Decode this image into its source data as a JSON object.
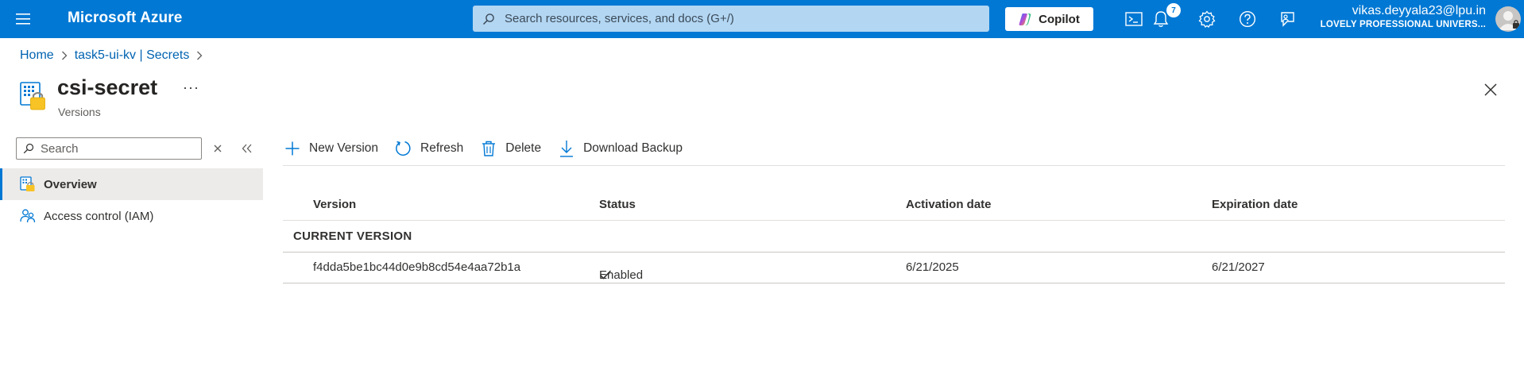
{
  "topbar": {
    "brand": "Microsoft Azure",
    "search_placeholder": "Search resources, services, and docs (G+/)",
    "copilot_label": "Copilot",
    "notification_count": "7",
    "account_email": "vikas.deyyala23@lpu.in",
    "account_org": "LOVELY PROFESSIONAL UNIVERS...",
    "icons": [
      "cloud-shell-icon",
      "notifications-icon",
      "settings-icon",
      "help-icon",
      "feedback-icon"
    ]
  },
  "breadcrumb": [
    {
      "label": "Home"
    },
    {
      "label": "task5-ui-kv | Secrets"
    }
  ],
  "page": {
    "title": "csi-secret",
    "more": "···",
    "subtitle": "Versions"
  },
  "nav": {
    "search_placeholder": "Search",
    "items": [
      {
        "label": "Overview",
        "icon": "overview-icon",
        "active": true
      },
      {
        "label": "Access control (IAM)",
        "icon": "iam-icon",
        "active": false
      }
    ]
  },
  "commands": [
    {
      "label": "New Version",
      "icon": "plus-icon"
    },
    {
      "label": "Refresh",
      "icon": "refresh-icon"
    },
    {
      "label": "Delete",
      "icon": "trash-icon"
    },
    {
      "label": "Download Backup",
      "icon": "download-icon"
    }
  ],
  "table": {
    "columns": [
      "Version",
      "Status",
      "Activation date",
      "Expiration date"
    ],
    "group_label": "CURRENT VERSION",
    "rows": [
      {
        "version": "f4dda5be1bc44d0e9b8cd54e4aa72b1a",
        "status": "Enabled",
        "activation": "6/21/2025",
        "expiration": "6/21/2027"
      }
    ]
  },
  "colors": {
    "accent": "#0078d4",
    "link": "#0063b1",
    "searchbox": "#b3d6f2",
    "nav_active": "#edebe9",
    "key_vault_yellow": "#f7c325"
  }
}
